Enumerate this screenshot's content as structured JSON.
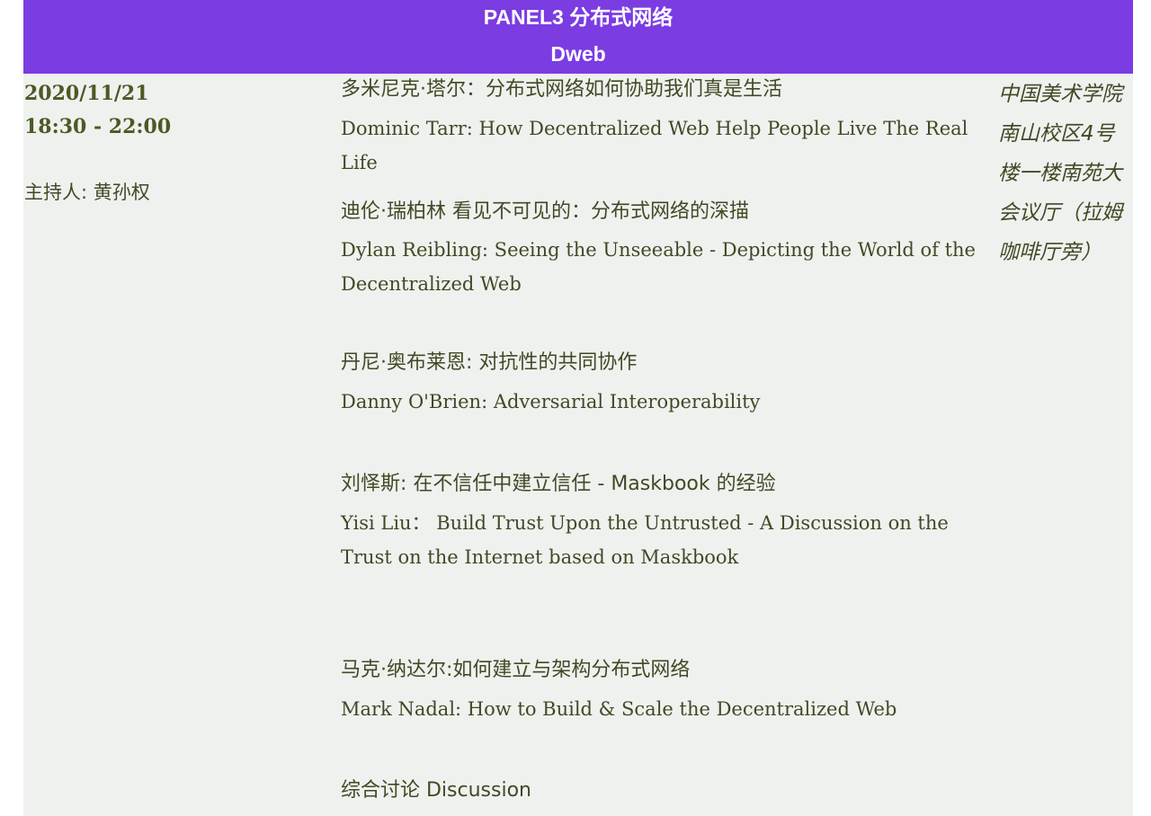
{
  "header": {
    "line1": "PANEL3 分布式网络",
    "line2": "Dweb"
  },
  "schedule": {
    "date": "2020/11/21",
    "time": "18:30 - 22:00",
    "host": "主持人: 黄孙权",
    "venue": "中国美术学院南山校区4号楼一楼南苑大会议厅（拉姆咖啡厅旁）"
  },
  "talks": [
    {
      "zh": "多米尼克·塔尔：分布式网络如何协助我们真是生活",
      "en": "Dominic Tarr: How Decentralized Web Help People Live The Real Life"
    },
    {
      "zh": "迪伦·瑞柏林 看见不可见的：分布式网络的深描",
      "en": "Dylan Reibling: Seeing the Unseeable - Depicting the World of the Decentralized Web"
    },
    {
      "zh": "丹尼·奥布莱恩: 对抗性的共同协作",
      "en": "Danny O'Brien: Adversarial Interoperability"
    },
    {
      "zh": "刘怿斯: 在不信任中建立信任 - Maskbook 的经验",
      "en": "Yisi Liu： Build Trust Upon the Untrusted - A Discussion on the Trust on the Internet based on Maskbook"
    },
    {
      "zh": "马克·纳达尔:如何建立与架构分布式网络",
      "en": "Mark Nadal: How to Build & Scale the Decentralized Web"
    },
    {
      "zh": "综合讨论 Discussion"
    }
  ]
}
